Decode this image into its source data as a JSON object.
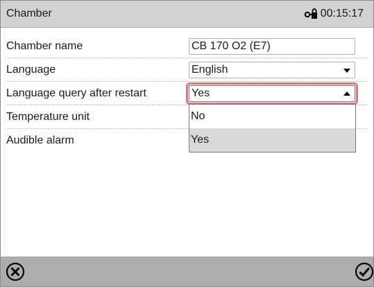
{
  "header": {
    "title": "Chamber",
    "time": "00:15:17",
    "lock_icon": "lock-key-icon"
  },
  "rows": [
    {
      "label": "Chamber name",
      "value": "CB 170 O2 (E7)"
    },
    {
      "label": "Language",
      "value": "English"
    },
    {
      "label": "Language query after restart",
      "value": "Yes"
    },
    {
      "label": "Temperature unit"
    },
    {
      "label": "Audible alarm"
    }
  ],
  "dropdown": {
    "options": [
      "No",
      "Yes"
    ],
    "selected": "Yes"
  },
  "footer": {
    "cancel_icon": "cancel-circle-x-icon",
    "confirm_icon": "confirm-check-icon"
  },
  "colors": {
    "header_bg": "#d2d2d2",
    "footer_bg": "#adadad",
    "highlight": "#e8727a",
    "selected_option_bg": "#d9d9d9"
  }
}
